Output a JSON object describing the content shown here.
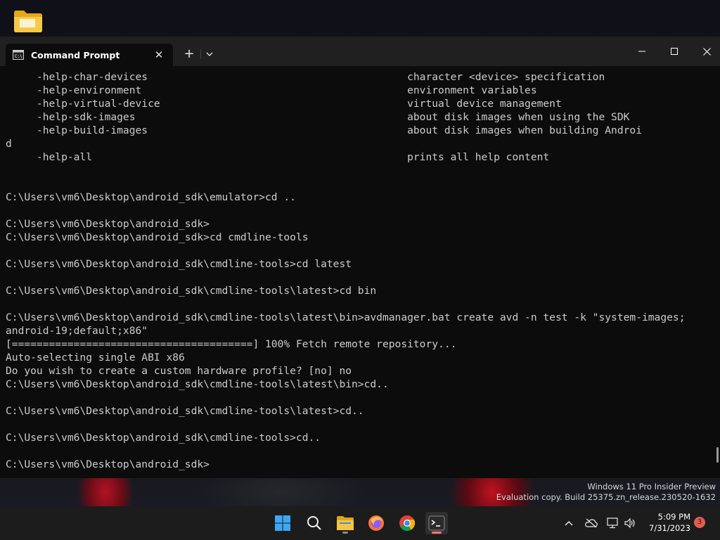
{
  "window": {
    "tab_title": "Command Prompt",
    "new_tab_glyph": "+",
    "tab_close_glyph": "✕"
  },
  "terminal": {
    "lines": [
      "     -help-char-devices                                          character <device> specification",
      "     -help-environment                                           environment variables",
      "     -help-virtual-device                                        virtual device management",
      "     -help-sdk-images                                            about disk images when using the SDK",
      "     -help-build-images                                          about disk images when building Androi",
      "d",
      "     -help-all                                                   prints all help content",
      "",
      "",
      "C:\\Users\\vm6\\Desktop\\android_sdk\\emulator>cd ..",
      "",
      "C:\\Users\\vm6\\Desktop\\android_sdk>",
      "C:\\Users\\vm6\\Desktop\\android_sdk>cd cmdline-tools",
      "",
      "C:\\Users\\vm6\\Desktop\\android_sdk\\cmdline-tools>cd latest",
      "",
      "C:\\Users\\vm6\\Desktop\\android_sdk\\cmdline-tools\\latest>cd bin",
      "",
      "C:\\Users\\vm6\\Desktop\\android_sdk\\cmdline-tools\\latest\\bin>avdmanager.bat create avd -n test -k \"system-images;",
      "android-19;default;x86\"",
      "[=======================================] 100% Fetch remote repository...",
      "Auto-selecting single ABI x86",
      "Do you wish to create a custom hardware profile? [no] no",
      "C:\\Users\\vm6\\Desktop\\android_sdk\\cmdline-tools\\latest\\bin>cd..",
      "",
      "C:\\Users\\vm6\\Desktop\\android_sdk\\cmdline-tools\\latest>cd..",
      "",
      "C:\\Users\\vm6\\Desktop\\android_sdk\\cmdline-tools>cd..",
      "",
      "C:\\Users\\vm6\\Desktop\\android_sdk>"
    ]
  },
  "watermark": {
    "line1": "Windows 11 Pro Insider Preview",
    "line2": "Evaluation copy. Build 25375.zn_release.230520-1632"
  },
  "taskbar": {
    "apps": [
      {
        "name": "start-icon",
        "active": false
      },
      {
        "name": "search-icon",
        "active": false
      },
      {
        "name": "file-explorer-icon",
        "active": false
      },
      {
        "name": "firefox-icon",
        "active": false
      },
      {
        "name": "chrome-icon",
        "active": false
      },
      {
        "name": "terminal-icon",
        "active": true
      }
    ],
    "tray": {
      "icons": [
        "chevron-up-icon",
        "cloud-offline-icon",
        "network-icon",
        "volume-icon"
      ],
      "time": "5:09 PM",
      "date": "7/31/2023",
      "notification_count": "3"
    }
  },
  "colors": {
    "terminal_bg": "#0c0c0c",
    "terminal_fg": "#cccccc",
    "titlebar_bg": "#202020",
    "taskbar_bg": "#1c1c1c",
    "accent_active": "#ff7a70",
    "badge": "#e25d4e"
  }
}
